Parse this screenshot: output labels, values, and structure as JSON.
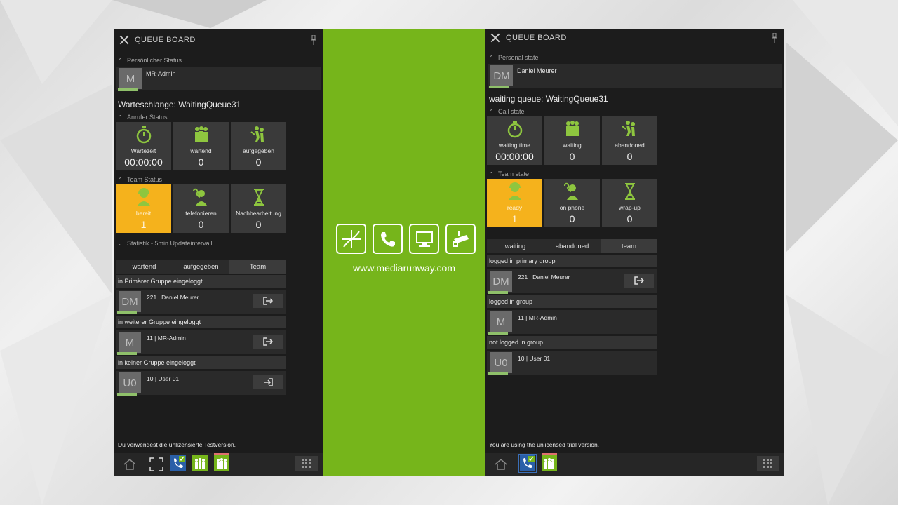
{
  "left": {
    "window_title": "QUEUE BOARD",
    "personal_status_label": "Persönlicher Status",
    "user": {
      "initials": "M",
      "name": "MR-Admin"
    },
    "queue_title": "Warteschlange: WaitingQueue31",
    "caller_status_label": "Anrufer Status",
    "caller_tiles": [
      {
        "label": "Wartezeit",
        "value": "00:00:00",
        "icon": "stopwatch-icon"
      },
      {
        "label": "wartend",
        "value": "0",
        "icon": "people-waiting-icon"
      },
      {
        "label": "aufgegeben",
        "value": "0",
        "icon": "people-abandoned-icon"
      }
    ],
    "team_status_label": "Team Status",
    "team_tiles": [
      {
        "label": "bereit",
        "value": "1",
        "icon": "headset-agent-icon"
      },
      {
        "label": "telefonieren",
        "value": "0",
        "icon": "agent-phone-icon"
      },
      {
        "label": "Nachbearbeitung",
        "value": "0",
        "icon": "hourglass-icon"
      }
    ],
    "stats_label": "Statistik - 5min Updateintervall",
    "tabs": [
      "wartend",
      "aufgegeben",
      "Team"
    ],
    "groups": [
      {
        "head": "in Primärer Gruppe eingeloggt",
        "member": {
          "initials": "DM",
          "name": "221 | Daniel Meurer"
        }
      },
      {
        "head": "in weiterer Gruppe eingeloggt",
        "member": {
          "initials": "M",
          "name": "11 | MR-Admin"
        }
      },
      {
        "head": "in keiner Gruppe eingeloggt",
        "member": {
          "initials": "U0",
          "name": "10 | User 01"
        }
      }
    ],
    "trial_text": "Du verwendest die unlizensierte Testversion."
  },
  "center": {
    "url": "www.mediarunway.com",
    "brand_color": "#76b51b"
  },
  "right": {
    "window_title": "QUEUE BOARD",
    "personal_status_label": "Personal state",
    "user": {
      "initials": "DM",
      "name": "Daniel Meurer"
    },
    "queue_title": "waiting queue: WaitingQueue31",
    "caller_status_label": "Call state",
    "caller_tiles": [
      {
        "label": "waiting time",
        "value": "00:00:00",
        "icon": "stopwatch-icon"
      },
      {
        "label": "waiting",
        "value": "0",
        "icon": "people-waiting-icon"
      },
      {
        "label": "abandoned",
        "value": "0",
        "icon": "people-abandoned-icon"
      }
    ],
    "team_status_label": "Team state",
    "team_tiles": [
      {
        "label": "ready",
        "value": "1",
        "icon": "headset-agent-icon"
      },
      {
        "label": "on phone",
        "value": "0",
        "icon": "agent-phone-icon"
      },
      {
        "label": "wrap-up",
        "value": "0",
        "icon": "hourglass-icon"
      }
    ],
    "tabs": [
      "waiting",
      "abandoned",
      "team"
    ],
    "groups": [
      {
        "head": "logged in primary group",
        "member": {
          "initials": "DM",
          "name": "221 | Daniel Meurer"
        }
      },
      {
        "head": "logged in group",
        "member": {
          "initials": "M",
          "name": "11 | MR-Admin"
        }
      },
      {
        "head": "not logged in group",
        "member": {
          "initials": "U0",
          "name": "10 | User 01"
        }
      }
    ],
    "trial_text": "You are using the unlicensed trial version."
  },
  "colors": {
    "accent_green": "#76b51b",
    "ready_yellow": "#f5b21c",
    "panel_bg": "#1c1c1c"
  }
}
